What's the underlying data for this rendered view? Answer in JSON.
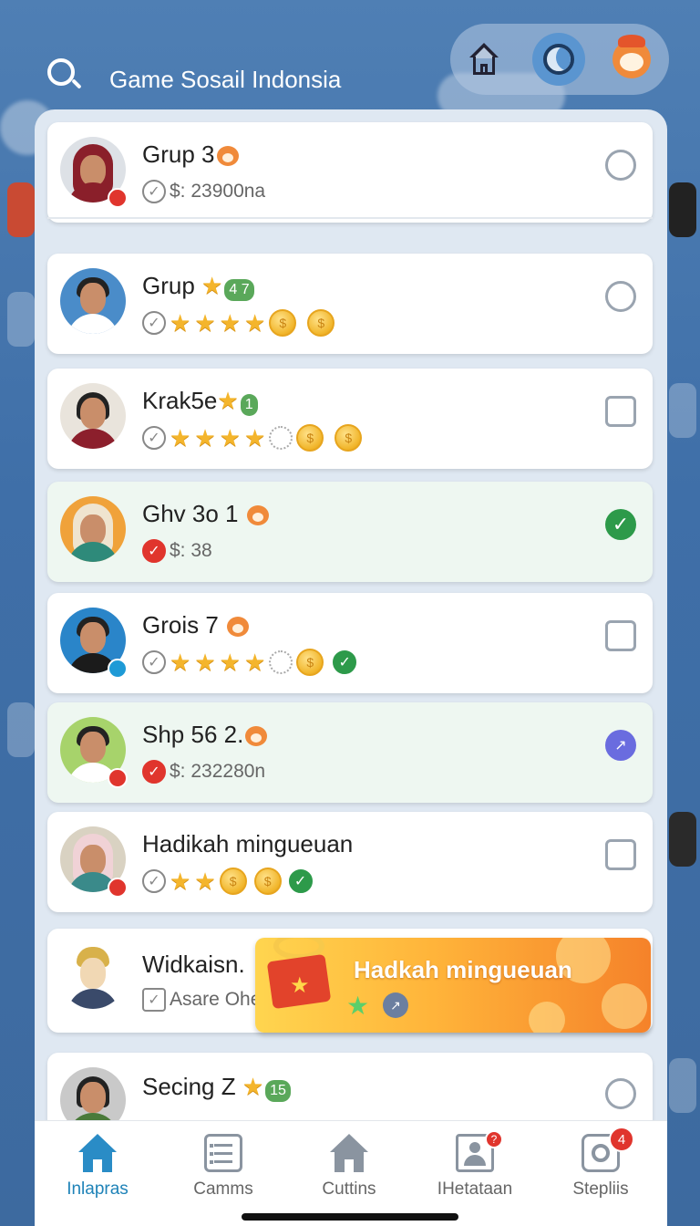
{
  "header": {
    "title": "Game Sosail Indonsia"
  },
  "rooms": [
    {
      "name": "Grup 3",
      "subtitle": "$: 23900na",
      "selector": "radio",
      "selected": false
    },
    {
      "name": "Grup",
      "tag": "4 7",
      "selector": "radio",
      "selected": false
    },
    {
      "name": "Krak5e",
      "tag": "1",
      "selector": "checkbox",
      "selected": false
    },
    {
      "name": "Ghv 3o 1",
      "subtitle": "$:  38",
      "selector": "check",
      "selected": true
    },
    {
      "name": "Grois 7",
      "selector": "checkbox",
      "selected": false
    },
    {
      "name": "Shp 56 2.",
      "subtitle": "$: 232280n",
      "selector": "trend",
      "selected": true
    },
    {
      "name": "Hadikah mingueuan",
      "selector": "checkbox",
      "selected": false
    },
    {
      "name": "Widkaisn.",
      "subtitle": "Asare Ohe",
      "selector": "none",
      "selected": false
    },
    {
      "name": "Secing Z",
      "tag": "15",
      "selector": "radio",
      "selected": false
    }
  ],
  "reward": {
    "title": "Hadkah mingueuan"
  },
  "nav": {
    "items": [
      {
        "label": "Inlapras",
        "active": true
      },
      {
        "label": "Camms",
        "active": false
      },
      {
        "label": "Cuttins",
        "active": false
      },
      {
        "label": "IHetataan",
        "active": false,
        "badge": "?"
      },
      {
        "label": "Stepliis",
        "active": false,
        "badge": "4"
      }
    ]
  },
  "colors": {
    "background": "#4f7fb4",
    "accent": "#2a8cc6",
    "success": "#2d9a4a",
    "danger": "#e0352d",
    "reward_start": "#ffd54f",
    "reward_end": "#f5822a"
  }
}
